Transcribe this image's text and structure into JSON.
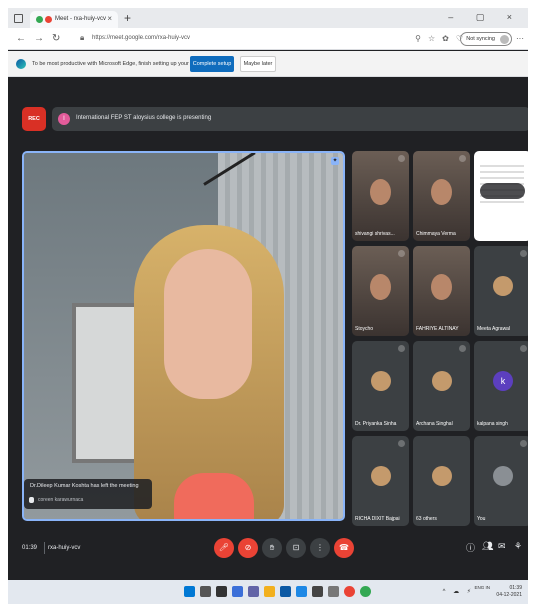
{
  "browser": {
    "tab_title": "Meet - rxa-huiy-vcv",
    "tab_close": "×",
    "new_tab": "+",
    "window_controls": "–   ▢   ×",
    "url": "https://meet.google.com/rxa-huiy-vcv",
    "sync_label": "Not syncing",
    "more": "···"
  },
  "infobar": {
    "message": "To be most productive with Microsoft Edge, finish setting up your browser.",
    "primary_button": "Complete setup",
    "secondary_button": "Maybe later"
  },
  "meet": {
    "rec_label": "REC",
    "presenting_initial": "I",
    "presenting_text": "International FEP ST aloysius college is presenting",
    "toast_message": "Dr.Dileep Kumar Koshta has left the meeting",
    "speaker_name": "coreen karawurnaca",
    "participants": [
      {
        "name": "shivangi shrivas...",
        "type": "video"
      },
      {
        "name": "Chimmaya Verma",
        "type": "video"
      },
      {
        "name": "",
        "type": "screen"
      },
      {
        "name": "Stoycho",
        "type": "video"
      },
      {
        "name": "FAHRIYE ALTINAY",
        "type": "video"
      },
      {
        "name": "Meeta Agrawal",
        "type": "avatar"
      },
      {
        "name": "Dr. Priyanka Sinha",
        "type": "avatar"
      },
      {
        "name": "Archana Singhal",
        "type": "avatar"
      },
      {
        "name": "kalpana singh",
        "type": "letter",
        "initial": "k"
      },
      {
        "name": "RICHA DIXIT Bajpai",
        "type": "avatar"
      },
      {
        "name": "63 others",
        "type": "group"
      },
      {
        "name": "You",
        "type": "avatar"
      }
    ],
    "time": "01:39",
    "meeting_code": "rxa-huiy-vcv"
  },
  "taskbar": {
    "lang": "ENG IN",
    "clock_time": "01:39",
    "clock_date": "04-12-2021"
  },
  "colors": {
    "meet_bg": "#202124",
    "tile_bg": "#3c4043",
    "red": "#ea4335",
    "accent_blue": "#8ab4f8",
    "edge_blue": "#0f6cbd"
  }
}
